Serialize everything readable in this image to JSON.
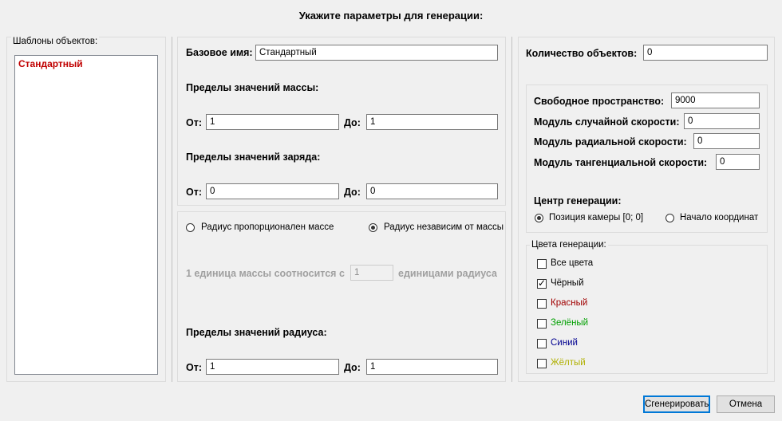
{
  "dialog": {
    "title": "Укажите параметры для генерации:"
  },
  "templates": {
    "label": "Шаблоны объектов:",
    "items": [
      "Стандартный"
    ]
  },
  "middle": {
    "base_name_label": "Базовое имя:",
    "base_name_value": "Стандартный",
    "mass_limits_label": "Пределы значений массы:",
    "from_label": "От:",
    "to_label": "До:",
    "mass_from": "1",
    "mass_to": "1",
    "charge_limits_label": "Пределы значений заряда:",
    "charge_from": "0",
    "charge_to": "0",
    "radius_prop_label": "Радиус пропорционален массе",
    "radius_indep_label": "Радиус независим от массы",
    "ratio_prefix": "1 единица массы соотносится с",
    "ratio_value": "1",
    "ratio_suffix": "единицами радиуса",
    "radius_limits_label": "Пределы значений радиуса:",
    "radius_from": "1",
    "radius_to": "1"
  },
  "right": {
    "count_label": "Количество объектов:",
    "count_value": "0",
    "free_space_label": "Свободное пространство:",
    "free_space_value": "9000",
    "random_speed_label": "Модуль случайной скорости:",
    "random_speed_value": "0",
    "radial_speed_label": "Модуль радиальной скорости:",
    "radial_speed_value": "0",
    "tangential_speed_label": "Модуль тангенциальной скорости:",
    "tangential_speed_value": "0",
    "center_label": "Центр генерации:",
    "center_camera_label": "Позиция камеры [0; 0]",
    "center_origin_label": "Начало координат",
    "colors_label": "Цвета генерации:",
    "colors": [
      {
        "label": "Все цвета",
        "checked": false,
        "color": "#000000"
      },
      {
        "label": "Чёрный",
        "checked": true,
        "color": "#000000"
      },
      {
        "label": "Красный",
        "checked": false,
        "color": "#a00000"
      },
      {
        "label": "Зелёный",
        "checked": false,
        "color": "#00a000"
      },
      {
        "label": "Синий",
        "checked": false,
        "color": "#000090"
      },
      {
        "label": "Жёлтый",
        "checked": false,
        "color": "#b0b000"
      }
    ]
  },
  "buttons": {
    "generate": "Сгенерировать",
    "cancel": "Отмена"
  }
}
